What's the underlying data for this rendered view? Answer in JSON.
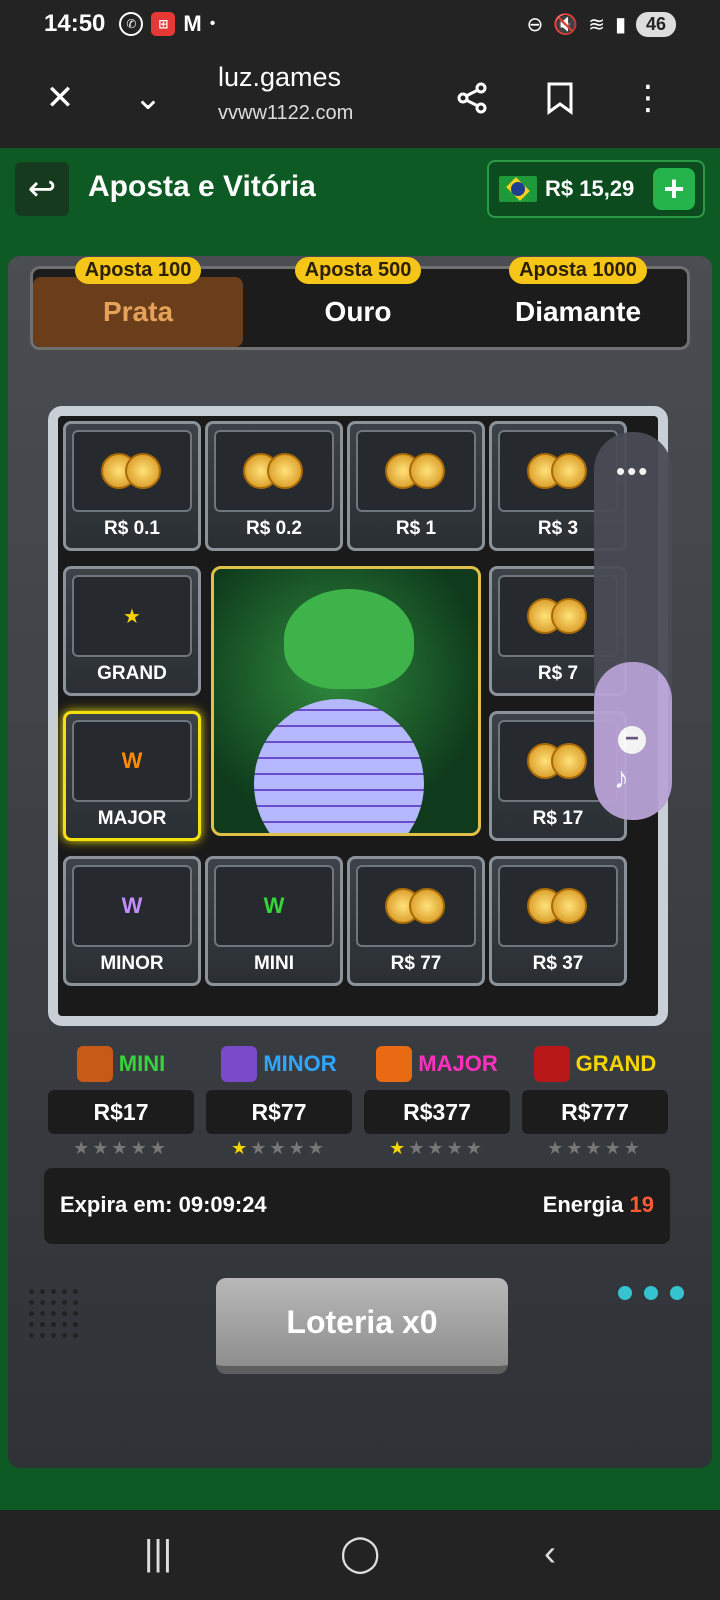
{
  "status_bar": {
    "time": "14:50",
    "battery": "46"
  },
  "browser": {
    "title": "luz.games",
    "subtitle": "vvww1122.com"
  },
  "game_header": {
    "title": "Aposta e Vitória",
    "balance": "R$ 15,29"
  },
  "tiers": [
    {
      "badge": "Aposta 100",
      "label": "Prata",
      "active": true
    },
    {
      "badge": "Aposta 500",
      "label": "Ouro",
      "active": false
    },
    {
      "badge": "Aposta 1000",
      "label": "Diamante",
      "active": false
    }
  ],
  "grid": {
    "cells": [
      {
        "label": "R$ 0.1"
      },
      {
        "label": "R$ 0.2"
      },
      {
        "label": "R$ 1"
      },
      {
        "label": "R$ 3"
      },
      {
        "label": "GRAND"
      },
      {
        "label": "R$ 7"
      },
      {
        "label": "MAJOR"
      },
      {
        "label": "R$ 17"
      },
      {
        "label": "MINOR"
      },
      {
        "label": "MINI"
      },
      {
        "label": "R$ 77"
      },
      {
        "label": "R$ 37"
      }
    ]
  },
  "jackpots": [
    {
      "title": "MINI",
      "value": "R$17",
      "stars": 0,
      "color": "#37d33a"
    },
    {
      "title": "MINOR",
      "value": "R$77",
      "stars": 1,
      "color": "#2fa6ff"
    },
    {
      "title": "MAJOR",
      "value": "R$377",
      "stars": 1,
      "color": "#ff2fc0"
    },
    {
      "title": "GRAND",
      "value": "R$777",
      "stars": 0,
      "color": "#f5d400"
    }
  ],
  "info": {
    "expire": "Expira em: 09:09:24",
    "energy_label": "Energia",
    "energy_value": "19"
  },
  "lottery": {
    "label": "Loteria x0"
  },
  "icons": {
    "close": "close-icon",
    "expand": "chevron-down-icon",
    "share": "share-icon",
    "bookmark": "bookmark-icon",
    "menu": "more-vertical-icon",
    "back": "back-arrow-icon"
  },
  "colors": {
    "accent": "#25b34c",
    "gold": "#f5c518",
    "bg": "#0d5a24"
  }
}
